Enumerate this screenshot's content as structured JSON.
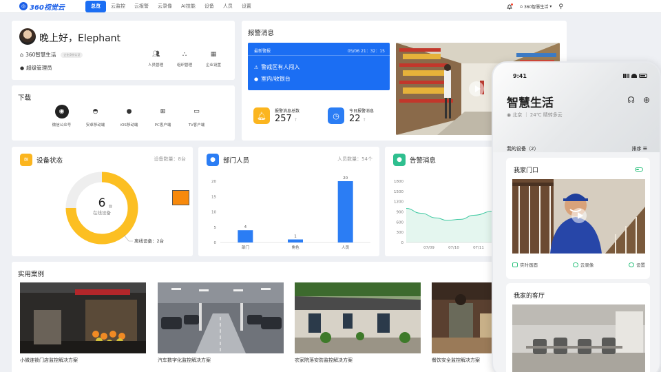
{
  "header": {
    "logo_text": "360视觉云",
    "nav": [
      {
        "label": "总览",
        "active": true
      },
      {
        "label": "云监控"
      },
      {
        "label": "云报警"
      },
      {
        "label": "云录像"
      },
      {
        "label": "AI技能"
      },
      {
        "label": "设备"
      },
      {
        "label": "人员"
      },
      {
        "label": "设置"
      }
    ],
    "org_name": "360智慧生活"
  },
  "greeting": {
    "title": "晚上好，Elephant",
    "org": "360智慧生活",
    "org_badge": "企业身份认证",
    "role": "超级管理员",
    "actions": [
      {
        "label": "人员管理",
        "icon": "people-icon"
      },
      {
        "label": "组织管理",
        "icon": "org-icon"
      },
      {
        "label": "企业设置",
        "icon": "building-icon"
      }
    ]
  },
  "download": {
    "title": "下载",
    "items": [
      {
        "label": "微信公众号",
        "icon": "wechat-icon"
      },
      {
        "label": "安卓移动端",
        "icon": "android-icon"
      },
      {
        "label": "iOS移动端",
        "icon": "apple-icon"
      },
      {
        "label": "PC客户端",
        "icon": "windows-icon"
      },
      {
        "label": "TV客户端",
        "icon": "tv-icon"
      }
    ]
  },
  "alarm": {
    "title": "报警消息",
    "latest_label": "最新警报",
    "latest_time": "05/06 21：32：15",
    "latest_event": "警戒区有人闯入",
    "latest_location": "室内/收银台",
    "total_label": "报警消息总数",
    "total_value": "257",
    "today_label": "今日报警消息",
    "today_value": "22",
    "trend_arrow": "↑",
    "colors": {
      "total": "#fbb51f",
      "today": "#2b7df4"
    }
  },
  "device_status": {
    "title": "设备状态",
    "count_label": "设备数量：8台",
    "online_value": "6",
    "online_unit": "台",
    "online_label": "在线设备",
    "offline_label": "离线设备：2台",
    "online_count": 6,
    "offline_count": 2,
    "colors": {
      "online": "#fcbf22",
      "offline": "#eeeeee"
    }
  },
  "department": {
    "title": "部门人员",
    "count_label": "人员数量：54个"
  },
  "alerts": {
    "title": "告警消息"
  },
  "cases": {
    "title": "实用案例",
    "items": [
      {
        "label": "小微连锁门店监控解决方案"
      },
      {
        "label": "汽车数字化监控解决方案"
      },
      {
        "label": "农家院落安防监控解决方案"
      },
      {
        "label": "餐饮安全监控解决方案"
      }
    ]
  },
  "phone": {
    "time": "9:41",
    "title": "智慧生活",
    "weather": "北京 ｜ 24℃ 晴转多云",
    "my_devices": "我的设备（2）",
    "sort": "排序",
    "devices": [
      {
        "name": "我家门口",
        "actions": [
          "实时画面",
          "云录像",
          "设置"
        ]
      },
      {
        "name": "我家的客厅"
      }
    ]
  },
  "chart_data": [
    {
      "type": "pie",
      "title": "设备状态",
      "categories": [
        "在线设备",
        "离线设备"
      ],
      "values": [
        6,
        2
      ]
    },
    {
      "type": "bar",
      "title": "部门人员",
      "categories": [
        "部门",
        "角色",
        "人员"
      ],
      "values": [
        4,
        1,
        20
      ],
      "yticks": [
        0,
        5,
        10,
        15,
        20
      ],
      "ylim": [
        0,
        20
      ],
      "color": "#2b7df4"
    },
    {
      "type": "area",
      "title": "告警消息",
      "x": [
        "07/09",
        "07/10",
        "07/11"
      ],
      "yticks": [
        0,
        300,
        600,
        900,
        1200,
        1500,
        1800
      ],
      "ylim": [
        0,
        1800
      ],
      "series": [
        {
          "values": [
            1000,
            650,
            920
          ]
        }
      ],
      "color": "#3cc8a0"
    }
  ]
}
